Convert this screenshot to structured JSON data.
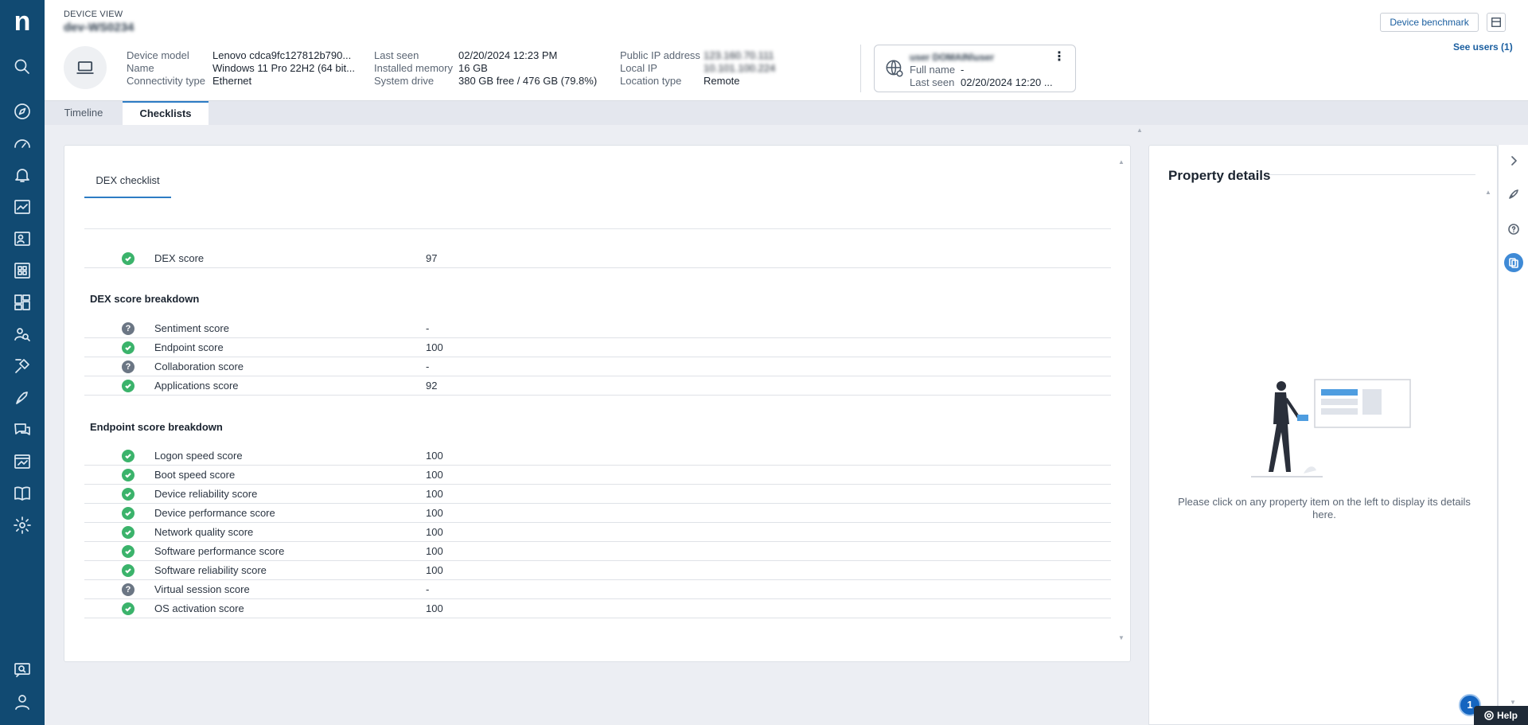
{
  "header": {
    "view_label": "DEVICE VIEW",
    "device_name": "dev-WS0234",
    "col1": [
      {
        "label": "Device model",
        "value": "Lenovo cdca9fc127812b790..."
      },
      {
        "label": "Name",
        "value": "Windows 11 Pro 22H2 (64 bit..."
      },
      {
        "label": "Connectivity type",
        "value": "Ethernet"
      }
    ],
    "col2": [
      {
        "label": "Last seen",
        "value": "02/20/2024 12:23 PM"
      },
      {
        "label": "Installed memory",
        "value": "16 GB"
      },
      {
        "label": "System drive",
        "value": "380 GB free / 476 GB (79.8%)"
      }
    ],
    "col3": [
      {
        "label": "Public IP address",
        "value": "123.160.70.111"
      },
      {
        "label": "Local IP",
        "value": "10.101.100.224"
      },
      {
        "label": "Location type",
        "value": "Remote"
      }
    ],
    "user_card": {
      "username": "user DOMAIN\\user",
      "full_name_label": "Full name",
      "full_name_value": "-",
      "last_seen_label": "Last seen",
      "last_seen_value": "02/20/2024 12:20 ..."
    },
    "benchmark_button": "Device benchmark",
    "see_users": "See users (1)"
  },
  "tabs": [
    "Timeline",
    "Checklists"
  ],
  "checklist": {
    "tab_label": "DEX checklist",
    "score_row": {
      "name": "DEX score",
      "value": "97",
      "status": "ok"
    },
    "sections": [
      {
        "title": "DEX score breakdown",
        "rows": [
          {
            "name": "Sentiment score",
            "value": "-",
            "status": "unknown"
          },
          {
            "name": "Endpoint score",
            "value": "100",
            "status": "ok"
          },
          {
            "name": "Collaboration score",
            "value": "-",
            "status": "unknown"
          },
          {
            "name": "Applications score",
            "value": "92",
            "status": "ok"
          }
        ]
      },
      {
        "title": "Endpoint score breakdown",
        "rows": [
          {
            "name": "Logon speed score",
            "value": "100",
            "status": "ok"
          },
          {
            "name": "Boot speed score",
            "value": "100",
            "status": "ok"
          },
          {
            "name": "Device reliability score",
            "value": "100",
            "status": "ok"
          },
          {
            "name": "Device performance score",
            "value": "100",
            "status": "ok"
          },
          {
            "name": "Network quality score",
            "value": "100",
            "status": "ok"
          },
          {
            "name": "Software performance score",
            "value": "100",
            "status": "ok"
          },
          {
            "name": "Software reliability score",
            "value": "100",
            "status": "ok"
          },
          {
            "name": "Virtual session score",
            "value": "-",
            "status": "unknown"
          },
          {
            "name": "OS activation score",
            "value": "100",
            "status": "ok"
          }
        ]
      }
    ]
  },
  "property_details": {
    "title": "Property details",
    "message": "Please click on any property item on the left to display its details here."
  },
  "help": {
    "badge": "1",
    "label": "Help"
  },
  "colors": {
    "nav": "#114a72",
    "accent": "#2d7cc4",
    "ok": "#3bb36b",
    "unknown": "#6b7684"
  }
}
